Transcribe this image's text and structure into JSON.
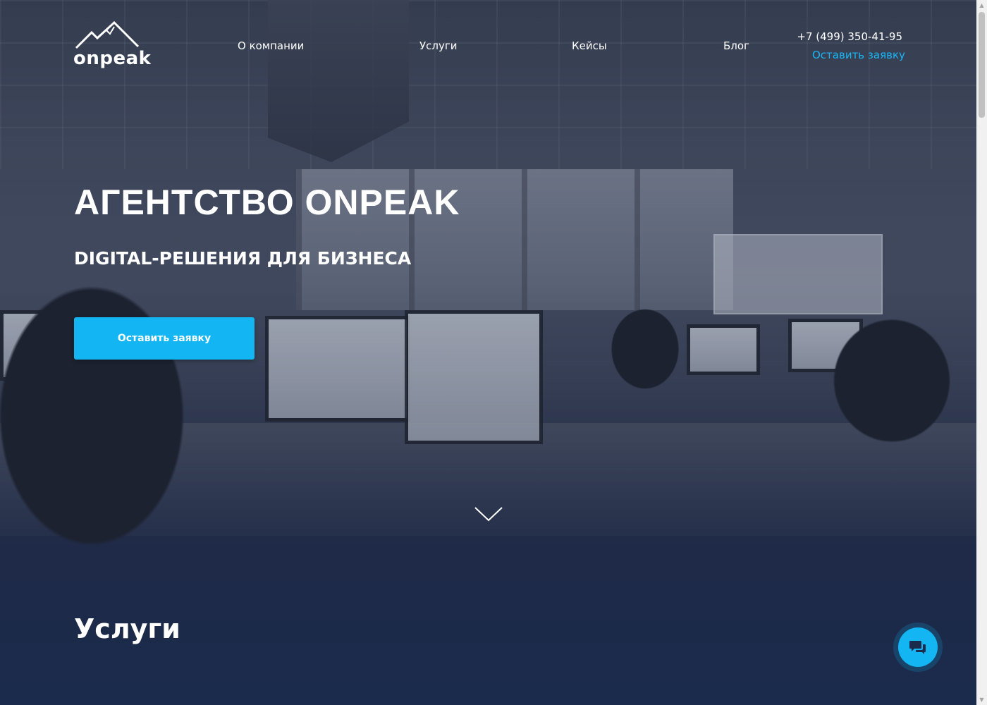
{
  "brand": {
    "logo_text": "onpeak",
    "logo_icon": "mountain-logo-icon"
  },
  "nav": {
    "items": [
      {
        "label": "О компании"
      },
      {
        "label": "Услуги"
      },
      {
        "label": "Кейсы"
      },
      {
        "label": "Блог"
      }
    ]
  },
  "contact": {
    "phone": "+7 (499) 350-41-95",
    "request_link": "Оставить заявку"
  },
  "hero": {
    "title": "АГЕНТСТВО ONPEAK",
    "subtitle": "DIGITAL-РЕШЕНИЯ ДЛЯ БИЗНЕСА",
    "button_label": "Оставить заявку",
    "scroll_icon": "chevron-down-icon"
  },
  "services": {
    "title": "Услуги"
  },
  "chat": {
    "icon": "chat-bubbles-icon"
  },
  "colors": {
    "accent": "#13b5f3",
    "link": "#19b6f5",
    "background_dark": "#1b2b4d",
    "text": "#ffffff"
  }
}
